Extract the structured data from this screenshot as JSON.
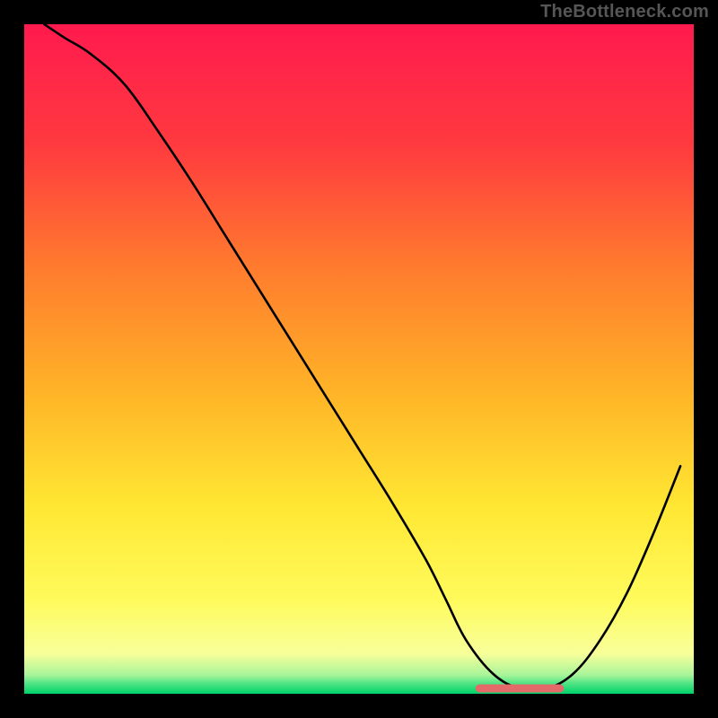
{
  "watermark": "TheBottleneck.com",
  "colors": {
    "gradient_stops": [
      {
        "offset": 0.0,
        "color": "#ff1a4e"
      },
      {
        "offset": 0.18,
        "color": "#ff3a3f"
      },
      {
        "offset": 0.36,
        "color": "#ff7a2e"
      },
      {
        "offset": 0.55,
        "color": "#ffb427"
      },
      {
        "offset": 0.72,
        "color": "#ffe733"
      },
      {
        "offset": 0.86,
        "color": "#fffb5c"
      },
      {
        "offset": 0.94,
        "color": "#f8ff9a"
      },
      {
        "offset": 0.972,
        "color": "#a8f59a"
      },
      {
        "offset": 0.985,
        "color": "#4de483"
      },
      {
        "offset": 1.0,
        "color": "#00d26a"
      }
    ],
    "curve": "#000000",
    "flat_segment": "#e46a6a",
    "background": "#000000"
  },
  "chart_data": {
    "type": "line",
    "title": "",
    "xlabel": "",
    "ylabel": "",
    "xlim": [
      0,
      100
    ],
    "ylim": [
      0,
      100
    ],
    "series": [
      {
        "name": "bottleneck-curve",
        "x": [
          3,
          6,
          10,
          15,
          20,
          25,
          30,
          35,
          40,
          45,
          50,
          55,
          60,
          63,
          66,
          70,
          74,
          78,
          82,
          86,
          90,
          94,
          98
        ],
        "y": [
          100,
          98,
          95.5,
          91,
          84,
          76.5,
          68.5,
          60.5,
          52.5,
          44.5,
          36.5,
          28.5,
          20,
          14,
          8,
          3,
          0.8,
          0.8,
          3,
          8,
          15,
          24,
          34
        ]
      }
    ],
    "flat_segment": {
      "x_start": 68,
      "x_end": 80,
      "y": 0.8
    }
  }
}
